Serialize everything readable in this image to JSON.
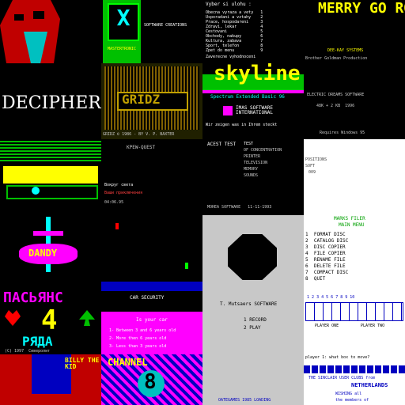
{
  "colors": {
    "yellow": "#ffff00",
    "cyan": "#00ffff",
    "magenta": "#ff00ff",
    "green": "#00c000",
    "bright_green": "#00ff00",
    "red": "#ff0000",
    "blue": "#0000ff",
    "white": "#ffffff",
    "grey": "#c8c8c8",
    "black": "#000000"
  },
  "tiles": {
    "r1c2": {
      "label": "MASTERTRONIC",
      "sub": "SOFTWARE CREATIONS"
    },
    "r1c3": {
      "header": "Vyber si ulohu :",
      "menu": [
        "Obecna vyraza a vety   1",
        "Usporadani a vztahy    2",
        "Prace, hospodareni     3",
        "Zdravi, lekar          4",
        "Cestovani              5",
        "Obchody, nakupy        6",
        "Kultura, zabava        7",
        "Sport, telefon         8",
        "Zpet do menu           9"
      ],
      "footer": "Zaverecne vyhodnoceni"
    },
    "r1c5": {
      "title": "MERRY GO ROUND",
      "credit": "DEE-KAY SYSTEMS",
      "footer": "Brother Goldman Production"
    },
    "r2c1": {
      "title": "DECIPHER"
    },
    "r2c2": {
      "title": "GRIDZ",
      "credit": "GRIDZ © 1986 - BY V. P. BAXTER"
    },
    "r2c3": {
      "title": "skyline",
      "sub": "Spectrum Extended Basic 96",
      "logo": "IMAS SOFTWARE INTERNATIONAL",
      "footer": "Wir zeigen was in Ihrem steckt"
    },
    "r2c4": {
      "lines": [
        "ELECTRIC DREAMS SOFTWARE",
        "48K + 2 KB  1996"
      ],
      "footer": "Requires Windows 95"
    },
    "r3c2": {
      "title": "KPEW-QUEST",
      "lines": [
        "Вокруг света",
        "Ваши приключения",
        "04:06.95"
      ]
    },
    "r3c3": {
      "header": "ACEST TEST",
      "items": [
        "TEST",
        "OF CONCENTRATION",
        "PRINTER",
        "TELEVISION",
        "MEMORY",
        "SOUNDS"
      ],
      "footer": "MOHEA SOFTWARE   11-11-1993"
    },
    "r3c4": {
      "lines": [
        "POSITIONS",
        "SOFT",
        "009"
      ]
    },
    "r4c1": {
      "title": "DANDY"
    },
    "r4c4": {
      "title": "MARKS FILER",
      "sub": "MAIN MENU",
      "menu": [
        "1  FORMAT DISC",
        "2  CATALOG DISC",
        "3  DISC COPIER",
        "4  FILE COPIER",
        "5  RENAME FILE",
        "6  DELETE FILE",
        "7  COMPACT DISC",
        "8  QUIT"
      ]
    },
    "r5c1": {
      "title": "ПАСЬЯНС",
      "number": "4",
      "sub": "РЯДА",
      "credit": "(C) 1997  Сиверолит"
    },
    "r5c2": {
      "header": "CAR SECURITY",
      "question": "Is your car",
      "options": [
        "1- Between 3 and 6 years old",
        "2- More then 6 years old",
        "3- Less than 3 years old"
      ]
    },
    "r5c3": {
      "title": "T. Mutsaers SOFTWARE",
      "menu": [
        "1 RECORD",
        "2 PLAY"
      ]
    },
    "r5c4": {
      "numbers": [
        "1",
        "2",
        "3",
        "4",
        "5",
        "6",
        "7",
        "8",
        "9",
        "10"
      ],
      "left_label": "PLAYER ONE",
      "right_label": "PLAYER TWO"
    },
    "r6c1": {
      "title": "BILLY THE KID"
    },
    "r6c2": {
      "title": "CHANNEL",
      "number": "8",
      "footer": "SELECT A NUMBER"
    },
    "r6c3": {
      "footer": "OATEGAMES 1985 LOADING"
    },
    "r6c4": {
      "header": "player 1: what box to move?",
      "title": "NETHERLANDS",
      "line1": "THE SINCLAIR USER CLUBS from",
      "line2": "WISHING all",
      "line3": "the members of"
    }
  }
}
